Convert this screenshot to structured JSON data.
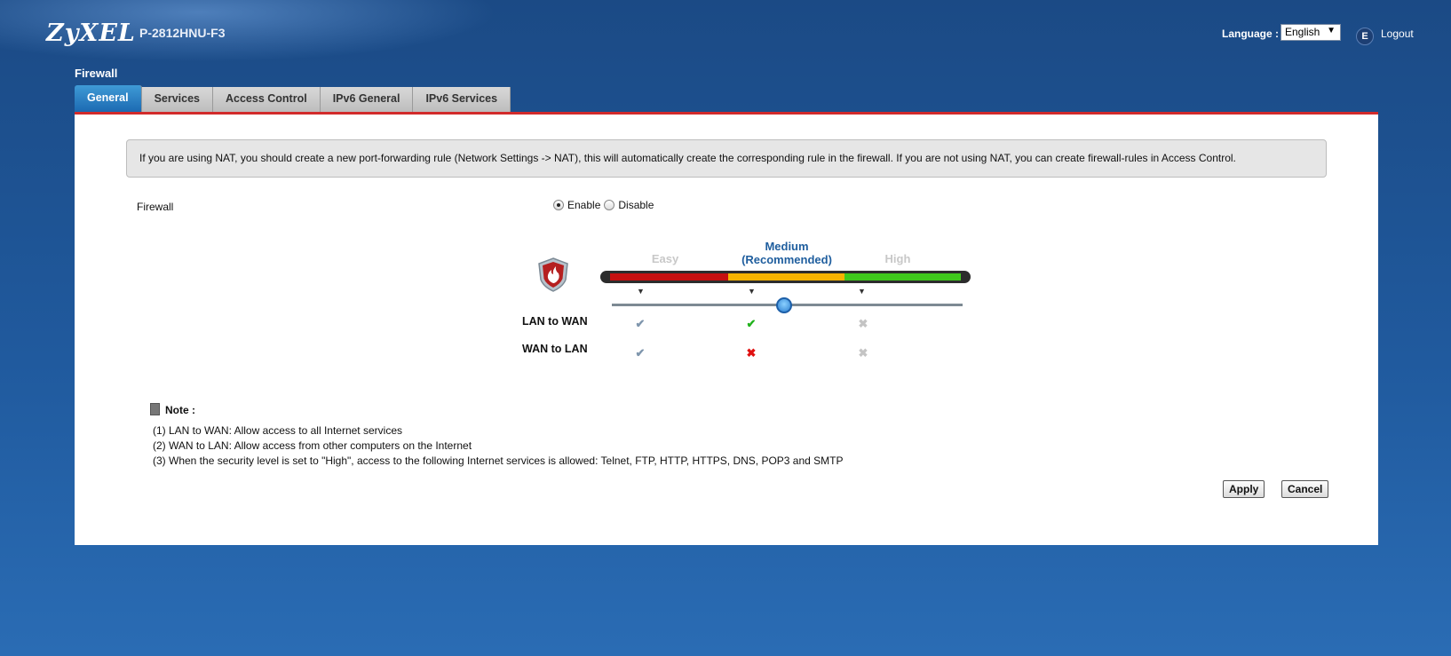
{
  "header": {
    "logo": "ZyXEL",
    "model": "P-2812HNU-F3",
    "language_label": "Language :",
    "language_value": "English",
    "logout_label": "Logout"
  },
  "page": {
    "section_title": "Firewall",
    "tabs": [
      {
        "label": "General",
        "active": true
      },
      {
        "label": "Services",
        "active": false
      },
      {
        "label": "Access Control",
        "active": false
      },
      {
        "label": "IPv6 General",
        "active": false
      },
      {
        "label": "IPv6 Services",
        "active": false
      }
    ]
  },
  "panel": {
    "info_text": "If you are using NAT, you should create a new port-forwarding rule (Network Settings -> NAT), this will automatically create the corresponding rule in the firewall. If you are not using NAT, you can create firewall-rules in Access Control.",
    "firewall_label": "Firewall",
    "enable_label": "Enable",
    "disable_label": "Disable",
    "firewall_state": "Enable"
  },
  "security_level": {
    "levels": [
      "Easy",
      "Medium\n(Recommended)",
      "High"
    ],
    "easy_label": "Easy",
    "medium_label_1": "Medium",
    "medium_label_2": "(Recommended)",
    "high_label": "High",
    "selected": "Medium",
    "rows": [
      {
        "label": "LAN to WAN",
        "easy": "allow",
        "medium": "allow",
        "high": "deny"
      },
      {
        "label": "WAN to LAN",
        "easy": "allow",
        "medium": "deny",
        "high": "deny"
      }
    ]
  },
  "note": {
    "title": "Note :",
    "lines": [
      "(1) LAN to WAN: Allow access to all Internet services",
      "(2) WAN to LAN: Allow access from other computers on the Internet",
      "(3) When the security level is set to \"High\", access to the following Internet services is allowed: Telnet, FTP, HTTP, HTTPS, DNS, POP3 and SMTP"
    ]
  },
  "buttons": {
    "apply": "Apply",
    "cancel": "Cancel"
  },
  "colors": {
    "tab_active": "#1c6ab2",
    "accent_line": "#d22b2b",
    "level_easy": "#c71010",
    "level_medium": "#f6b300",
    "level_high": "#3fc91c"
  }
}
